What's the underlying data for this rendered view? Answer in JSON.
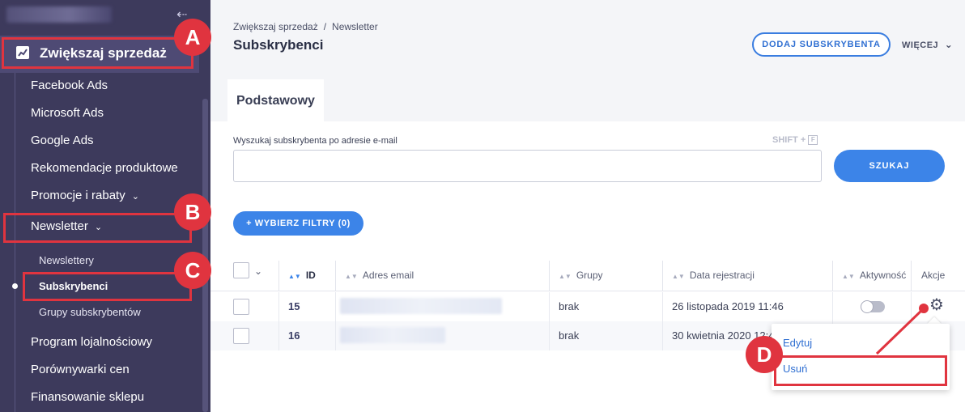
{
  "sidebar": {
    "main_section": "Zwiększaj sprzedaż",
    "items": [
      {
        "label": "Facebook Ads"
      },
      {
        "label": "Microsoft Ads"
      },
      {
        "label": "Google Ads"
      },
      {
        "label": "Rekomendacje produktowe"
      },
      {
        "label": "Promocje i rabaty"
      },
      {
        "label": "Newsletter"
      }
    ],
    "sub_items": [
      {
        "label": "Newslettery"
      },
      {
        "label": "Subskrybenci"
      },
      {
        "label": "Grupy subskrybentów"
      }
    ],
    "more_items": [
      {
        "label": "Program lojalnościowy"
      },
      {
        "label": "Porównywarki cen"
      },
      {
        "label": "Finansowanie sklepu"
      }
    ]
  },
  "markers": [
    "A",
    "B",
    "C",
    "D"
  ],
  "header": {
    "breadcrumb": [
      "Zwiększaj sprzedaż",
      "Newsletter"
    ],
    "breadcrumb_sep": "/",
    "title": "Subskrybenci",
    "add_button": "DODAJ SUBSKRYBENTA",
    "more_button": "WIĘCEJ"
  },
  "tabs": [
    {
      "label": "Podstawowy"
    }
  ],
  "search": {
    "label": "Wyszukaj subskrybenta po adresie e-mail",
    "shortcut": "SHIFT +",
    "shortcut_key": "F",
    "button": "SZUKAJ",
    "value": ""
  },
  "filters_button": "+ WYBIERZ FILTRY (0)",
  "table": {
    "columns": [
      "ID",
      "Adres email",
      "Grupy",
      "Data rejestracji",
      "Aktywność",
      "Akcje"
    ],
    "rows": [
      {
        "id": "15",
        "groups": "brak",
        "date": "26 listopada 2019 11:46"
      },
      {
        "id": "16",
        "groups": "brak",
        "date": "30 kwietnia 2020 12:4"
      }
    ]
  },
  "row_menu": {
    "edit": "Edytuj",
    "delete": "Usuń"
  },
  "colors": {
    "accent": "#3c84e8",
    "sidebar": "#3d3a5c",
    "annotation": "#e0343f"
  }
}
